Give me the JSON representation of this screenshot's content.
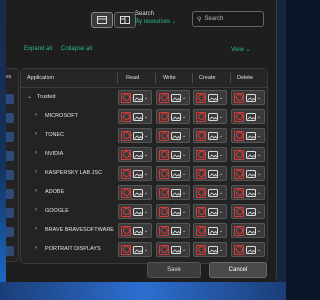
{
  "toolbar": {
    "search_label": "Search",
    "search_scope": "By resources",
    "search_placeholder": "Search"
  },
  "actions": {
    "expand_all": "Expand all",
    "collapse_all": "Collapse all",
    "view": "View"
  },
  "left_panel": {
    "header": "es"
  },
  "grid": {
    "columns": [
      "Application",
      "Read",
      "Write",
      "Create",
      "Delete"
    ],
    "group": "Trusted",
    "rows": [
      "MICROSOFT",
      "TONEC",
      "NVIDIA",
      "KASPERSKY LAB JSC",
      "ADOBE",
      "GOOGLE",
      "BRAVE BRAVESOFTWARE",
      "PORTRAIT DISPLAYS"
    ]
  },
  "buttons": {
    "save": "Save",
    "cancel": "Cancel"
  },
  "colors": {
    "accent": "#2dbc96",
    "deny": "#d03c3c",
    "background": "#1e1e1e"
  }
}
